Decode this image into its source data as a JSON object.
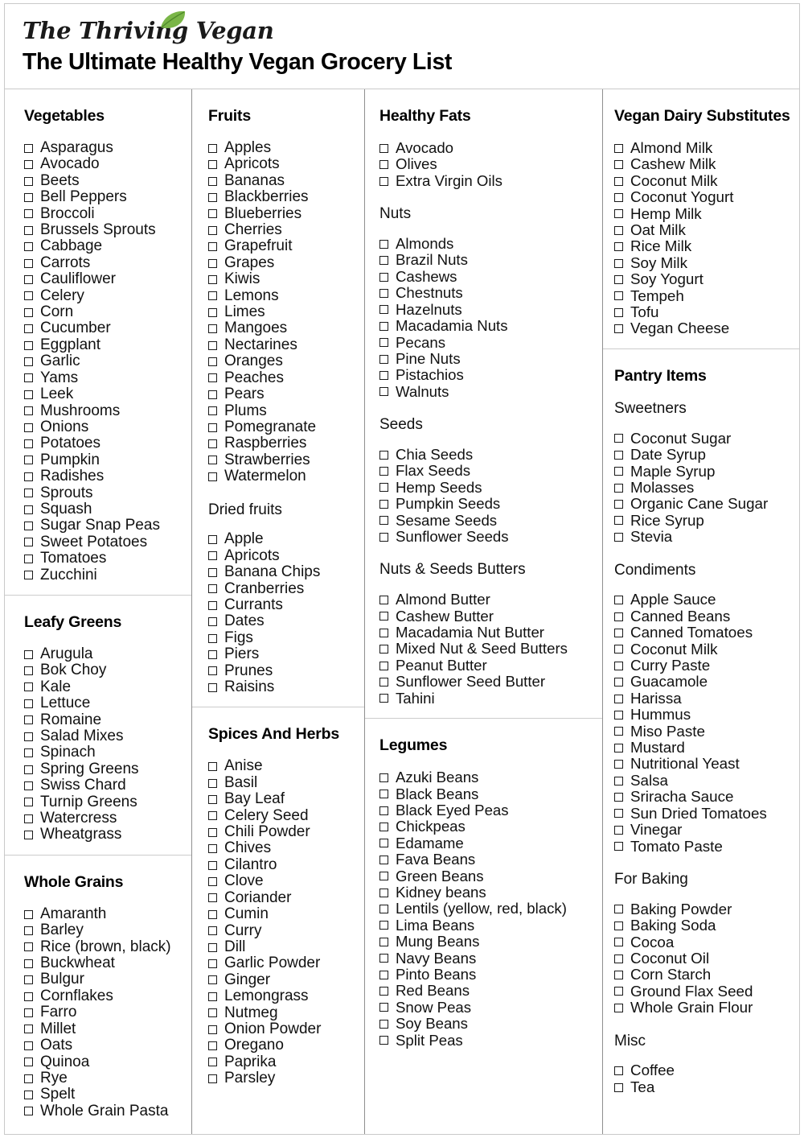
{
  "header": {
    "logo_text": "The Thriving Vegan",
    "logo_leaf_icon": "leaf-icon",
    "leaf_color": "#7ab648",
    "title": "The Ultimate Healthy Vegan Grocery List"
  },
  "columns": [
    {
      "id": "column-1",
      "blocks": [
        {
          "id": "vegetables",
          "heading": "Vegetables",
          "heading_style": "bold",
          "divider_above": false,
          "items": [
            "Asparagus",
            "Avocado",
            "Beets",
            "Bell Peppers",
            "Broccoli",
            "Brussels Sprouts",
            "Cabbage",
            "Carrots",
            "Cauliflower",
            "Celery",
            "Corn",
            "Cucumber",
            "Eggplant",
            "Garlic",
            "Yams",
            "Leek",
            "Mushrooms",
            "Onions",
            "Potatoes",
            "Pumpkin",
            "Radishes",
            "Sprouts",
            "Squash",
            "Sugar Snap Peas",
            "Sweet Potatoes",
            "Tomatoes",
            "Zucchini"
          ]
        },
        {
          "id": "leafy-greens",
          "heading": "Leafy Greens",
          "heading_style": "bold",
          "divider_above": true,
          "items": [
            "Arugula",
            "Bok Choy",
            "Kale",
            "Lettuce",
            "Romaine",
            "Salad Mixes",
            "Spinach",
            "Spring Greens",
            "Swiss Chard",
            "Turnip Greens",
            "Watercress",
            "Wheatgrass"
          ]
        },
        {
          "id": "whole-grains",
          "heading": "Whole Grains",
          "heading_style": "bold",
          "divider_above": true,
          "items": [
            "Amaranth",
            "Barley",
            "Rice (brown, black)",
            "Buckwheat",
            "Bulgur",
            "Cornflakes",
            "Farro",
            "Millet",
            "Oats",
            "Quinoa",
            "Rye",
            "Spelt",
            "Whole Grain Pasta"
          ]
        }
      ]
    },
    {
      "id": "column-2",
      "blocks": [
        {
          "id": "fruits",
          "heading": "Fruits",
          "heading_style": "bold",
          "divider_above": false,
          "items": [
            "Apples",
            "Apricots",
            "Bananas",
            "Blackberries",
            "Blueberries",
            "Cherries",
            "Grapefruit",
            "Grapes",
            "Kiwis",
            "Lemons",
            "Limes",
            "Mangoes",
            "Nectarines",
            "Oranges",
            "Peaches",
            "Pears",
            "Plums",
            "Pomegranate",
            "Raspberries",
            "Strawberries",
            "Watermelon"
          ],
          "subsections": [
            {
              "id": "dried-fruits",
              "heading": "Dried fruits",
              "heading_style": "regular",
              "items": [
                "Apple",
                "Apricots",
                "Banana Chips",
                "Cranberries",
                "Currants",
                "Dates",
                "Figs",
                "Piers",
                "Prunes",
                "Raisins"
              ]
            }
          ]
        },
        {
          "id": "spices-and-herbs",
          "heading": "Spices And Herbs",
          "heading_style": "bold",
          "divider_above": true,
          "items": [
            "Anise",
            "Basil",
            "Bay Leaf",
            "Celery Seed",
            "Chili Powder",
            "Chives",
            "Cilantro",
            "Clove",
            "Coriander",
            "Cumin",
            "Curry",
            "Dill",
            "Garlic Powder",
            "Ginger",
            "Lemongrass",
            "Nutmeg",
            "Onion Powder",
            "Oregano",
            "Paprika",
            "Parsley"
          ]
        }
      ]
    },
    {
      "id": "column-3",
      "blocks": [
        {
          "id": "healthy-fats",
          "heading": "Healthy Fats",
          "heading_style": "bold",
          "divider_above": false,
          "items": [
            "Avocado",
            "Olives",
            "Extra Virgin Oils"
          ],
          "subsections": [
            {
              "id": "nuts",
              "heading": "Nuts",
              "heading_style": "regular",
              "items": [
                "Almonds",
                "Brazil Nuts",
                "Cashews",
                "Chestnuts",
                "Hazelnuts",
                "Macadamia Nuts",
                "Pecans",
                "Pine Nuts",
                "Pistachios",
                "Walnuts"
              ]
            },
            {
              "id": "seeds",
              "heading": "Seeds",
              "heading_style": "regular",
              "items": [
                "Chia Seeds",
                "Flax Seeds",
                "Hemp Seeds",
                "Pumpkin Seeds",
                "Sesame Seeds",
                "Sunflower Seeds"
              ]
            },
            {
              "id": "nuts-and-seeds-butters",
              "heading": "Nuts & Seeds Butters",
              "heading_style": "regular",
              "items": [
                "Almond Butter",
                "Cashew Butter",
                "Macadamia Nut Butter",
                "Mixed Nut & Seed Butters",
                "Peanut Butter",
                "Sunflower Seed Butter",
                "Tahini"
              ]
            }
          ]
        },
        {
          "id": "legumes",
          "heading": "Legumes",
          "heading_style": "bold",
          "divider_above": true,
          "items": [
            "Azuki Beans",
            "Black Beans",
            "Black Eyed Peas",
            "Chickpeas",
            "Edamame",
            "Fava Beans",
            "Green Beans",
            "Kidney beans",
            "Lentils (yellow, red, black)",
            "Lima Beans",
            "Mung Beans",
            "Navy Beans",
            "Pinto Beans",
            "Red Beans",
            "Snow Peas",
            "Soy Beans",
            "Split Peas"
          ]
        }
      ]
    },
    {
      "id": "column-4",
      "blocks": [
        {
          "id": "vegan-dairy-substitutes",
          "heading": "Vegan Dairy Substitutes",
          "heading_style": "bold",
          "divider_above": false,
          "items": [
            "Almond Milk",
            "Cashew Milk",
            "Coconut Milk",
            "Coconut Yogurt",
            "Hemp Milk",
            "Oat Milk",
            "Rice Milk",
            "Soy Milk",
            "Soy Yogurt",
            "Tempeh",
            "Tofu",
            "Vegan Cheese"
          ]
        },
        {
          "id": "pantry-items",
          "heading": "Pantry Items",
          "heading_style": "bold",
          "divider_above": true,
          "items": [],
          "subsections": [
            {
              "id": "sweetners",
              "heading": "Sweetners",
              "heading_style": "regular",
              "items": [
                "Coconut Sugar",
                "Date Syrup",
                "Maple Syrup",
                "Molasses",
                "Organic Cane Sugar",
                "Rice Syrup",
                "Stevia"
              ]
            },
            {
              "id": "condiments",
              "heading": "Condiments",
              "heading_style": "regular",
              "items": [
                "Apple Sauce",
                "Canned Beans",
                "Canned Tomatoes",
                "Coconut Milk",
                "Curry Paste",
                "Guacamole",
                "Harissa",
                "Hummus",
                "Miso Paste",
                "Mustard",
                "Nutritional Yeast",
                "Salsa",
                "Sriracha Sauce",
                "Sun Dried Tomatoes",
                "Vinegar",
                "Tomato Paste"
              ]
            },
            {
              "id": "for-baking",
              "heading": "For Baking",
              "heading_style": "regular",
              "items": [
                "Baking Powder",
                "Baking Soda",
                "Cocoa",
                "Coconut Oil",
                "Corn Starch",
                "Ground Flax Seed",
                "Whole Grain Flour"
              ]
            },
            {
              "id": "misc",
              "heading": "Misc",
              "heading_style": "regular",
              "items": [
                "Coffee",
                "Tea"
              ]
            }
          ]
        }
      ]
    }
  ]
}
